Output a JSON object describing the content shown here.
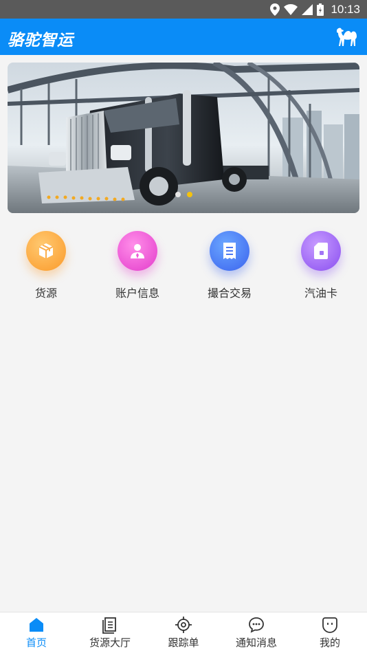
{
  "status_bar": {
    "time": "10:13"
  },
  "app_bar": {
    "title": "骆驼智运",
    "logo_icon": "camel-icon"
  },
  "banner": {
    "slides": 2,
    "active_slide": 2
  },
  "menu": [
    {
      "label": "货源",
      "icon": "package-icon",
      "color": "#fb9a2a"
    },
    {
      "label": "账户信息",
      "icon": "user-icon",
      "color": "#e33ccb"
    },
    {
      "label": "撮合交易",
      "icon": "document-icon",
      "color": "#3b63ee"
    },
    {
      "label": "汽油卡",
      "icon": "fuel-card-icon",
      "color": "#8a4ff0"
    }
  ],
  "bottom_nav": [
    {
      "label": "首页",
      "icon": "home-icon",
      "active": true
    },
    {
      "label": "货源大厅",
      "icon": "notebook-icon",
      "active": false
    },
    {
      "label": "跟踪单",
      "icon": "crosshair-icon",
      "active": false
    },
    {
      "label": "通知消息",
      "icon": "chat-bubble-icon",
      "active": false
    },
    {
      "label": "我的",
      "icon": "profile-icon",
      "active": false
    }
  ],
  "colors": {
    "primary": "#0a8cf7",
    "status_bar": "#5a5a5a",
    "background": "#f4f4f4"
  }
}
